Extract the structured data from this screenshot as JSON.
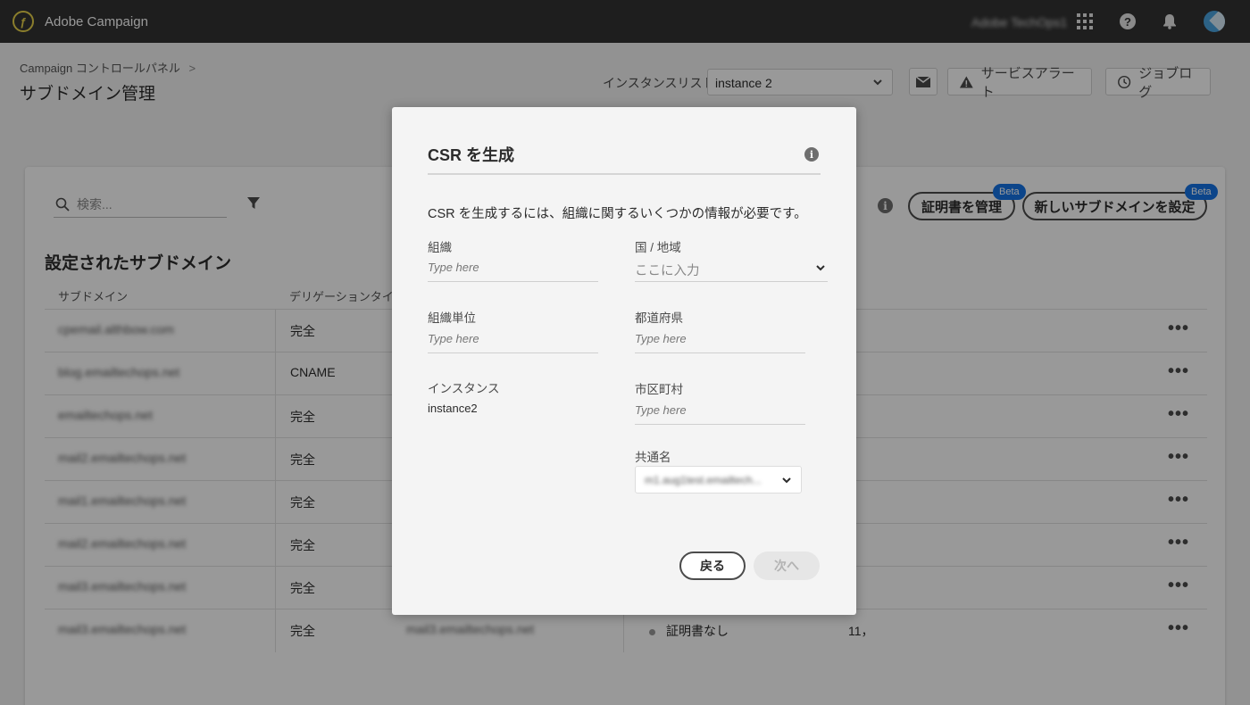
{
  "app": {
    "name": "Adobe Campaign",
    "org": "Adobe TechOps1"
  },
  "header": {
    "breadcrumb": "Campaign コントロールパネル",
    "breadcrumb_sep": ">",
    "title": "サブドメイン管理",
    "instance_label": "インスタンスリスト",
    "instance_value": "instance 2",
    "service_alert": "サービスアラート",
    "job_log": "ジョブログ"
  },
  "main": {
    "search_placeholder": "検索...",
    "manage_cert": "証明書を管理",
    "new_subdomain": "新しいサブドメインを設定",
    "beta": "Beta",
    "section_title": "設定されたサブドメイン",
    "columns": [
      "サブドメイン",
      "デリゲーションタイプ"
    ],
    "rows": [
      {
        "subdomain": "cpemail.althbow.com",
        "type": "完全"
      },
      {
        "subdomain": "blog.emailtechops.net",
        "type": "CNAME"
      },
      {
        "subdomain": "emailtechops.net",
        "type": "完全"
      },
      {
        "subdomain": "mail2.emailtechops.net",
        "type": "完全"
      },
      {
        "subdomain": "mail1.emailtechops.net",
        "type": "完全"
      },
      {
        "subdomain": "mail2.emailtechops.net",
        "type": "完全"
      },
      {
        "subdomain": "mail3.emailtechops.net",
        "type": "完全"
      },
      {
        "subdomain": "mail3.emailtechops.net",
        "type": "完全",
        "domain": "mail3.emailtechops.net",
        "cert_status": "証明書なし",
        "extra": "11，"
      }
    ]
  },
  "dialog": {
    "title": "CSR を生成",
    "description": "CSR を生成するには、組織に関するいくつかの情報が必要です。",
    "org_label": "組織",
    "org_placeholder": "Type here",
    "country_label": "国 / 地域",
    "country_placeholder": "ここに入力",
    "org_unit_label": "組織単位",
    "org_unit_placeholder": "Type here",
    "state_label": "都道府県",
    "state_placeholder": "Type here",
    "instance_label": "インスタンス",
    "instance_value": "instance2",
    "city_label": "市区町村",
    "city_placeholder": "Type here",
    "common_name_label": "共通名",
    "common_name_value": "m1.aug1test.emailtech...",
    "back": "戻る",
    "next": "次へ"
  },
  "colors": {
    "accent": "#1473e6",
    "topbar": "#323232",
    "logo": "#e8d34a"
  }
}
